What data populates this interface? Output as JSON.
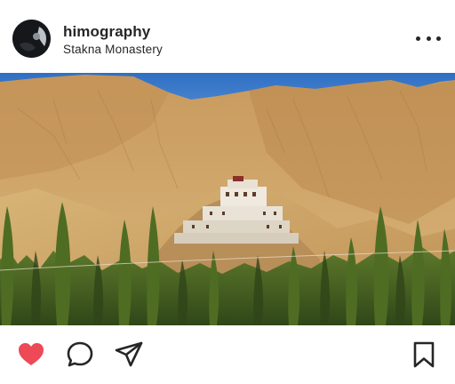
{
  "post": {
    "username": "himography",
    "location": "Stakna Monastery"
  },
  "icons": {
    "more": "more-horizontal-icon",
    "like": "heart-filled-icon",
    "comment": "comment-bubble-icon",
    "share": "paper-plane-icon",
    "save": "bookmark-icon"
  },
  "colors": {
    "like_active": "#ed4956",
    "icon": "#262626",
    "text": "#262626"
  }
}
